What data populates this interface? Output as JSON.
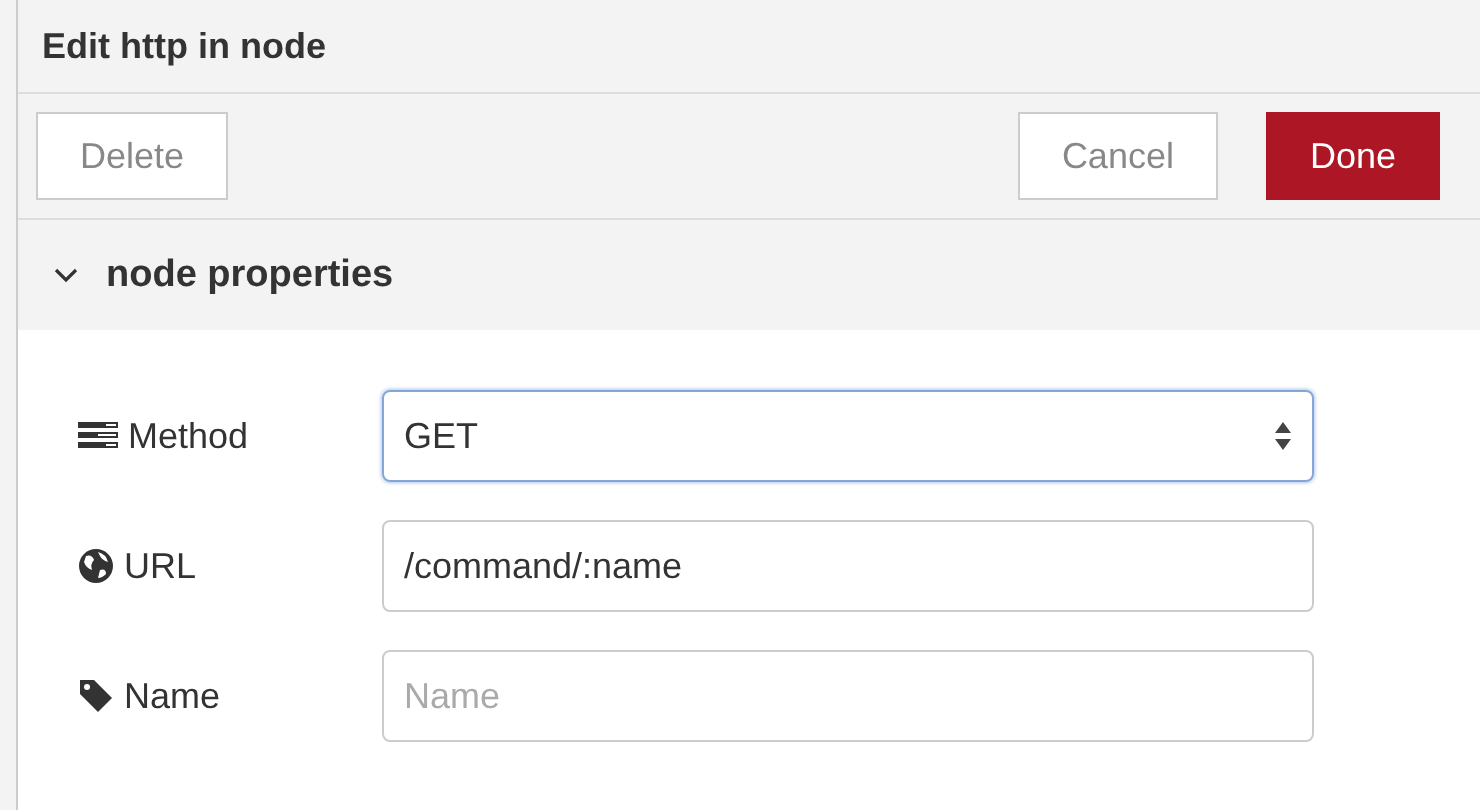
{
  "dialog": {
    "title": "Edit http in node"
  },
  "toolbar": {
    "left_buttons": [
      {
        "label": "Delete",
        "kind": "default"
      }
    ],
    "right_buttons": [
      {
        "label": "Cancel",
        "kind": "default"
      },
      {
        "label": "Done",
        "kind": "primary"
      }
    ]
  },
  "section": {
    "title": "node properties",
    "expanded": true
  },
  "fields": [
    {
      "label": "Method",
      "kind": "select",
      "value": "GET",
      "focused": true
    },
    {
      "label": "URL",
      "kind": "text",
      "value": "/command/:name",
      "focused": false
    },
    {
      "label": "Name",
      "kind": "text",
      "placeholder": "Name",
      "focused": false
    }
  ]
}
